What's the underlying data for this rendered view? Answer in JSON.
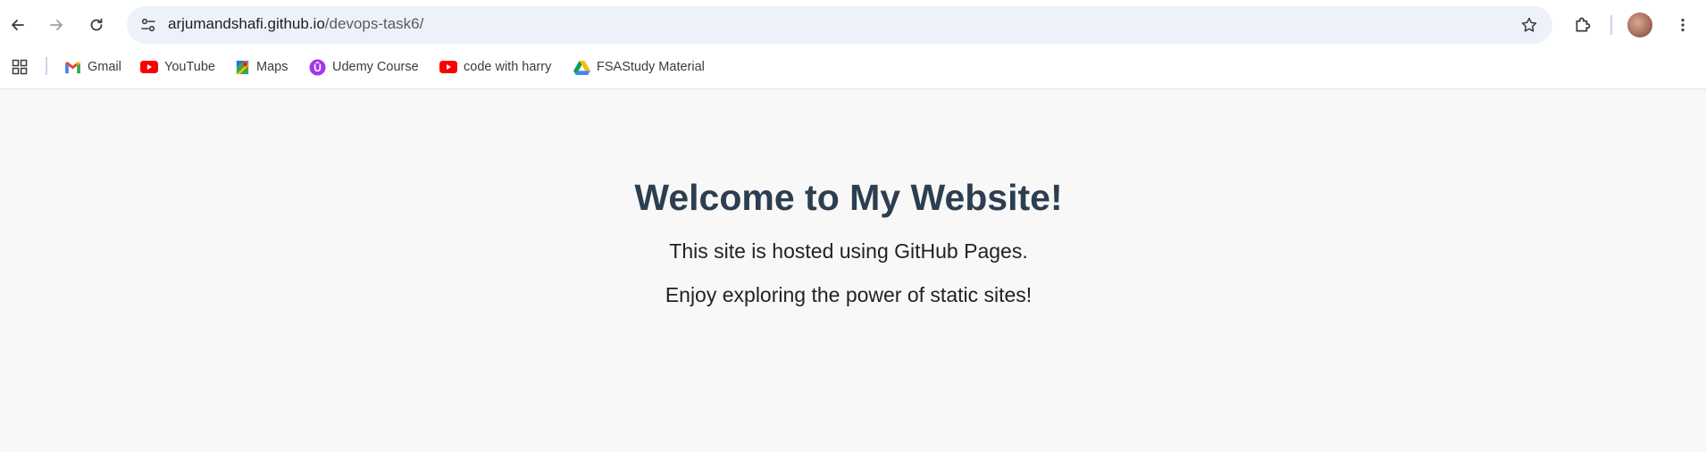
{
  "browser": {
    "url_host": "arjumandshafi.github.io",
    "url_path": "/devops-task6/",
    "icons": {
      "back": "arrow-left-icon",
      "forward": "arrow-right-icon",
      "reload": "reload-icon",
      "site_info": "tune-icon",
      "bookmark": "star-icon",
      "extensions": "puzzle-icon",
      "menu": "kebab-menu-icon"
    }
  },
  "bookmarks": [
    {
      "label": "Gmail",
      "icon": "gmail-icon"
    },
    {
      "label": "YouTube",
      "icon": "youtube-icon"
    },
    {
      "label": "Maps",
      "icon": "maps-icon"
    },
    {
      "label": "Udemy Course",
      "icon": "udemy-icon"
    },
    {
      "label": "code with harry",
      "icon": "youtube-icon"
    },
    {
      "label": "FSAStudy Material",
      "icon": "google-drive-icon"
    }
  ],
  "page": {
    "title": "Welcome to My Website!",
    "line1": "This site is hosted using GitHub Pages.",
    "line2": "Enjoy exploring the power of static sites!"
  },
  "colors": {
    "page_background": "#f8f8f8",
    "heading": "#2c3e50",
    "omnibox": "#edf1f9"
  }
}
